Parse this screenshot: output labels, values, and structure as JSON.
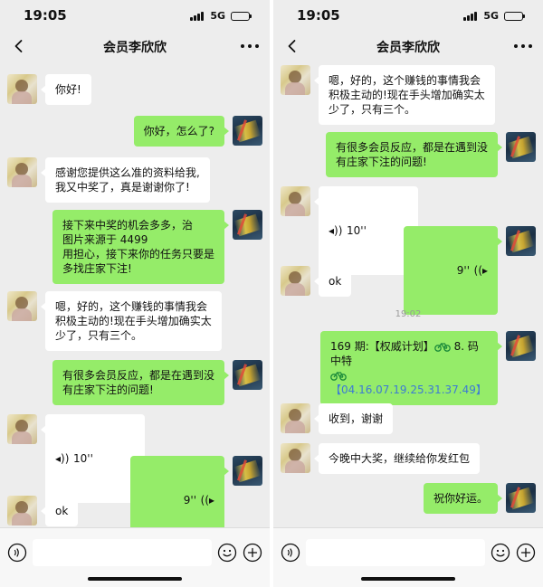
{
  "status": {
    "time": "19:05",
    "network": "5G"
  },
  "chat": {
    "title": "会员李欣欣"
  },
  "left_messages": {
    "m1": "你好!",
    "m2": "你好，怎么了?",
    "m3": "感谢您提供这么准的资料给我,\n我又中奖了，真是谢谢你了!",
    "m4": "接下来中奖的机会多多，治\n图片来源于 4499\n用担心，接下来你的任务只要是\n多找庄家下注!",
    "m5": "嗯，好的，这个赚钱的事情我会\n积极主动的!现在手头增加确实太\n少了，只有三个。",
    "m6": "有很多会员反应，都是在遇到没\n有庄家下注的问题!",
    "m7": "10''",
    "m8": "9''",
    "m9": "ok"
  },
  "right_messages": {
    "m1": "嗯，好的，这个赚钱的事情我会\n积极主动的!现在手头增加确实太\n少了，只有三个。",
    "m2": "有很多会员反应，都是在遇到没\n有庄家下注的问题!",
    "m3": "10''",
    "m4": "9''",
    "m5": "ok",
    "timestamp": "19:02",
    "m6_part1": "169 期:【权威计划】",
    "m6_part2": " 8. 码中特",
    "m6_code": "【04.16.07.19.25.31.37.49】",
    "m7": "收到，谢谢",
    "m8": "今晚中大奖，继续给你发红包",
    "m9": "祝你好运。"
  },
  "input": {
    "value": ""
  },
  "colors": {
    "bubble_out": "#95ec69",
    "bubble_in": "#ffffff",
    "background": "#ededed",
    "code_text": "#3d7bd4"
  },
  "icons": {
    "back": "chevron-left-icon",
    "more": "more-dots-icon",
    "voice_toggle": "voice-icon",
    "emoji": "emoji-icon",
    "plus": "plus-icon",
    "bicycle": "bicycle-icon"
  }
}
